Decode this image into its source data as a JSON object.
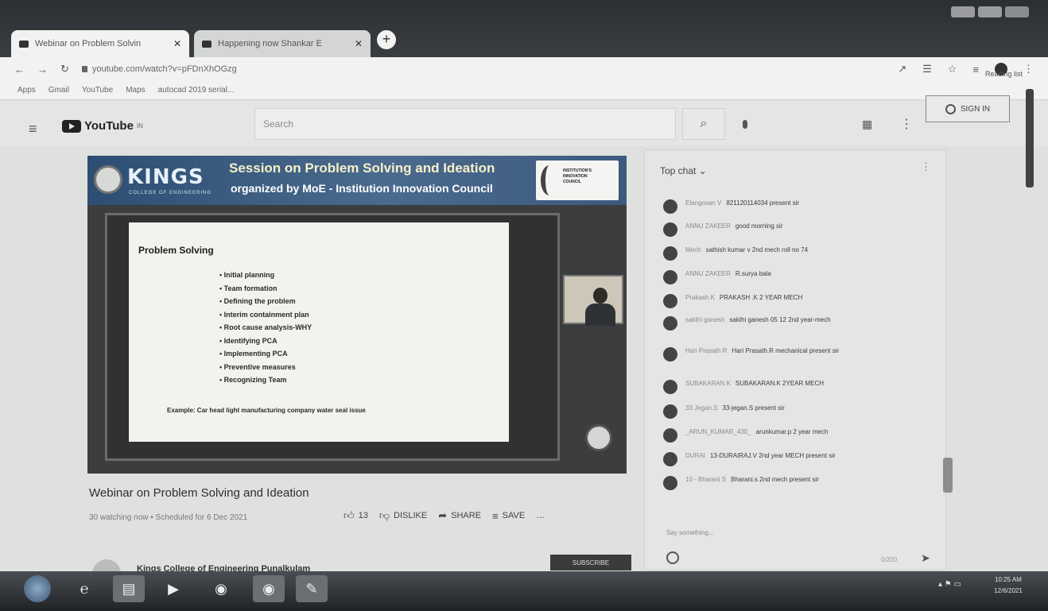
{
  "browser": {
    "tabs": [
      {
        "title": "Webinar on Problem Solvin",
        "active": true
      },
      {
        "title": "Happening now Shankar E",
        "active": false
      }
    ],
    "new_tab": "+",
    "url": "youtube.com/watch?v=pFDnXhOGzg",
    "reading_list": "Reading list",
    "bookmarks": [
      "Apps",
      "Gmail",
      "YouTube",
      "Maps",
      "autocad 2019 serial..."
    ]
  },
  "youtube": {
    "logo": "YouTube",
    "logo_sup": "IN",
    "search_placeholder": "Search",
    "sign_in": "SIGN IN"
  },
  "video": {
    "banner": {
      "kings": "KINGS",
      "kings_sub": "COLLEGE OF ENGINEERING",
      "line1": "Session on Problem Solving and Ideation",
      "line2": "organized by MoE - Institution Innovation Council",
      "logo_text": "INSTITUTION'S\nINNOVATION\nCOUNCIL"
    },
    "slide": {
      "title": "Problem Solving",
      "bullets": [
        "Initial planning",
        "Team formation",
        "Defining the problem",
        "Interim containment plan",
        "Root cause analysis-WHY",
        "Identifying PCA",
        "Implementing PCA",
        "Preventive measures",
        "Recognizing Team"
      ],
      "example": "Example: Car head light manufacturing company water seal issue"
    },
    "title": "Webinar on Problem Solving and Ideation",
    "meta": "30 watching now • Scheduled for 6 Dec 2021",
    "like_count": "13",
    "dislike": "DISLIKE",
    "share": "SHARE",
    "save": "SAVE",
    "more": "…"
  },
  "channel": {
    "name": "Kings College of Engineering Punalkulam",
    "subscribe": "SUBSCRIBE"
  },
  "chat": {
    "header": "Top chat ⌄",
    "messages": [
      {
        "author": "Elangovan V",
        "text": "821120114034 present sir"
      },
      {
        "author": "ANNU ZAKEER",
        "text": "good morning sir"
      },
      {
        "author": "Mech",
        "text": "sathish kumar v 2nd mech roll no 74"
      },
      {
        "author": "ANNU ZAKEER",
        "text": "R.surya bala"
      },
      {
        "author": "Prakash K",
        "text": "PRAKASH .K 2 YEAR MECH"
      },
      {
        "author": "sakthi ganesh",
        "text": "sakthi ganesh 05 12 2nd year-mech"
      },
      {
        "author": "Hari Prasath R",
        "text": "Hari Prasath.R mechanical present sir"
      },
      {
        "author": "SUBAKARAN K",
        "text": "SUBAKARAN.K 2YEAR MECH"
      },
      {
        "author": "33 Jegan.S",
        "text": "33-jegan.S present sir"
      },
      {
        "author": "_ARUN_KUMAR_430_",
        "text": "arunkumar.p 2 year mech"
      },
      {
        "author": "DURAI",
        "text": "13-DURAIRAJ.V 2nd year MECH present sir"
      },
      {
        "author": "10 - Bharani S",
        "text": "Bharani.s 2nd mech present sir"
      }
    ],
    "input_hint": "Say something...",
    "counter": "0/200"
  },
  "taskbar": {
    "clock_time": "10:25 AM",
    "clock_date": "12/6/2021"
  }
}
